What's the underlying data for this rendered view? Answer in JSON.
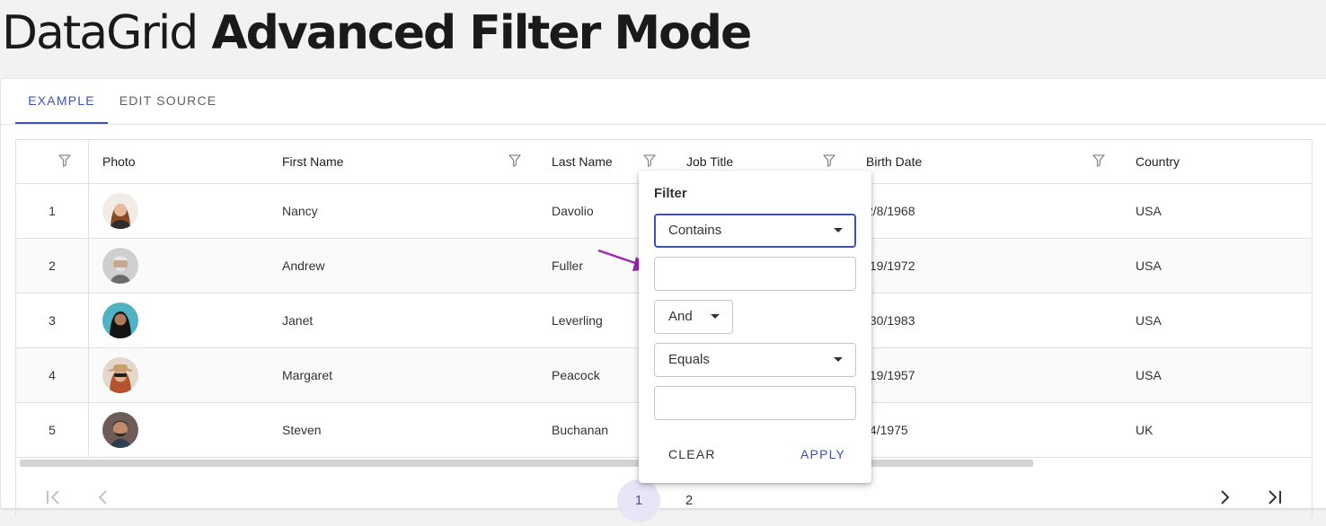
{
  "title": {
    "light": "DataGrid",
    "bold": "Advanced Filter Mode"
  },
  "tabs": [
    {
      "label": "EXAMPLE",
      "active": true
    },
    {
      "label": "EDIT SOURCE",
      "active": false
    }
  ],
  "grid": {
    "columns": [
      {
        "label": "",
        "filter": true
      },
      {
        "label": "Photo",
        "filter": false
      },
      {
        "label": "First Name",
        "filter": true
      },
      {
        "label": "Last Name",
        "filter": true
      },
      {
        "label": "Job Title",
        "filter": true
      },
      {
        "label": "Birth Date",
        "filter": true
      },
      {
        "label": "Country",
        "filter": false
      }
    ],
    "rows": [
      {
        "num": "1",
        "first": "Nancy",
        "last": "Davolio",
        "birth": "2/8/1968",
        "country": "USA"
      },
      {
        "num": "2",
        "first": "Andrew",
        "last": "Fuller",
        "birth": "/19/1972",
        "country": "USA"
      },
      {
        "num": "3",
        "first": "Janet",
        "last": "Leverling",
        "birth": "/30/1983",
        "country": "USA"
      },
      {
        "num": "4",
        "first": "Margaret",
        "last": "Peacock",
        "birth": "/19/1957",
        "country": "USA"
      },
      {
        "num": "5",
        "first": "Steven",
        "last": "Buchanan",
        "birth": "/4/1975",
        "country": "UK"
      }
    ]
  },
  "pager": {
    "first_icon": "first-page-icon",
    "prev_icon": "chevron-left-icon",
    "next_icon": "chevron-right-icon",
    "last_icon": "last-page-icon",
    "pages": [
      "1",
      "2"
    ],
    "current_page": "1"
  },
  "filter_popup": {
    "title": "Filter",
    "condition1": "Contains",
    "value1": "",
    "operator": "And",
    "condition2": "Equals",
    "value2": "",
    "clear_label": "CLEAR",
    "apply_label": "APPLY"
  },
  "colors": {
    "accent": "#3f51b5",
    "annotation_arrow": "#9c27b0",
    "current_page_bg": "#e8e6f6"
  }
}
